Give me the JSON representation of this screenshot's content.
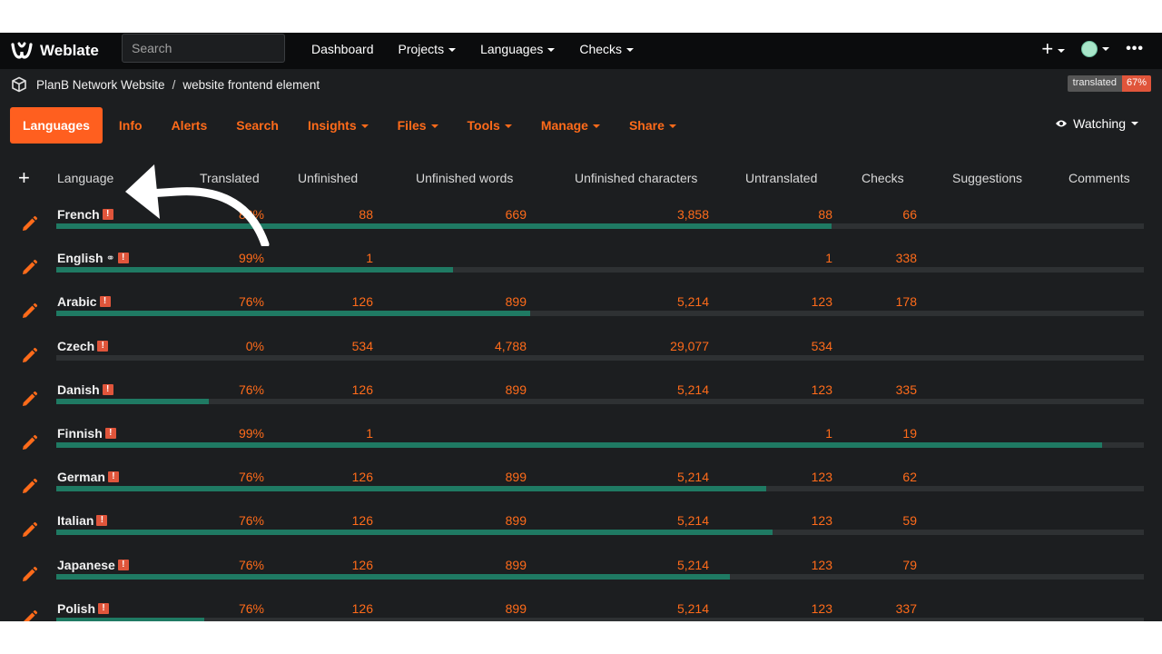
{
  "app": {
    "name": "Weblate"
  },
  "search": {
    "placeholder": "Search"
  },
  "nav": [
    "Dashboard",
    "Projects",
    "Languages",
    "Checks"
  ],
  "breadcrumb": {
    "project": "PlanB Network Website",
    "separator": "/",
    "component": "website frontend element"
  },
  "status_badge": {
    "label": "translated",
    "value": "67%"
  },
  "tabs": [
    "Languages",
    "Info",
    "Alerts",
    "Search",
    "Insights",
    "Files",
    "Tools",
    "Manage",
    "Share"
  ],
  "watching": {
    "label": "Watching"
  },
  "table": {
    "headers": {
      "language": "Language",
      "translated": "Translated",
      "unfinished": "Unfinished",
      "unfinished_words": "Unfinished words",
      "unfinished_characters": "Unfinished characters",
      "untranslated": "Untranslated",
      "checks": "Checks",
      "suggestions": "Suggestions",
      "comments": "Comments"
    },
    "rows": [
      {
        "language": "French",
        "translated": "83%",
        "unfinished": "88",
        "words": "669",
        "chars": "3,858",
        "untranslated": "88",
        "checks": "66",
        "progress": 0.713
      },
      {
        "language": "English",
        "translated": "99%",
        "unfinished": "1",
        "words": "",
        "chars": "",
        "untranslated": "1",
        "checks": "338",
        "progress": 0.365
      },
      {
        "language": "Arabic",
        "translated": "76%",
        "unfinished": "126",
        "words": "899",
        "chars": "5,214",
        "untranslated": "123",
        "checks": "178",
        "progress": 0.436
      },
      {
        "language": "Czech",
        "translated": "0%",
        "unfinished": "534",
        "words": "4,788",
        "chars": "29,077",
        "untranslated": "534",
        "checks": "",
        "progress": 0
      },
      {
        "language": "Danish",
        "translated": "76%",
        "unfinished": "126",
        "words": "899",
        "chars": "5,214",
        "untranslated": "123",
        "checks": "335",
        "progress": 0.14
      },
      {
        "language": "Finnish",
        "translated": "99%",
        "unfinished": "1",
        "words": "",
        "chars": "",
        "untranslated": "1",
        "checks": "19",
        "progress": 0.962
      },
      {
        "language": "German",
        "translated": "76%",
        "unfinished": "126",
        "words": "899",
        "chars": "5,214",
        "untranslated": "123",
        "checks": "62",
        "progress": 0.653
      },
      {
        "language": "Italian",
        "translated": "76%",
        "unfinished": "126",
        "words": "899",
        "chars": "5,214",
        "untranslated": "123",
        "checks": "59",
        "progress": 0.659
      },
      {
        "language": "Japanese",
        "translated": "76%",
        "unfinished": "126",
        "words": "899",
        "chars": "5,214",
        "untranslated": "123",
        "checks": "79",
        "progress": 0.619
      },
      {
        "language": "Polish",
        "translated": "76%",
        "unfinished": "126",
        "words": "899",
        "chars": "5,214",
        "untranslated": "123",
        "checks": "337",
        "progress": 0.136
      }
    ]
  },
  "colors": {
    "accent": "#ff5f1f",
    "progress": "#1f7a63",
    "background": "#1c1e20",
    "alert": "#e0553b"
  }
}
